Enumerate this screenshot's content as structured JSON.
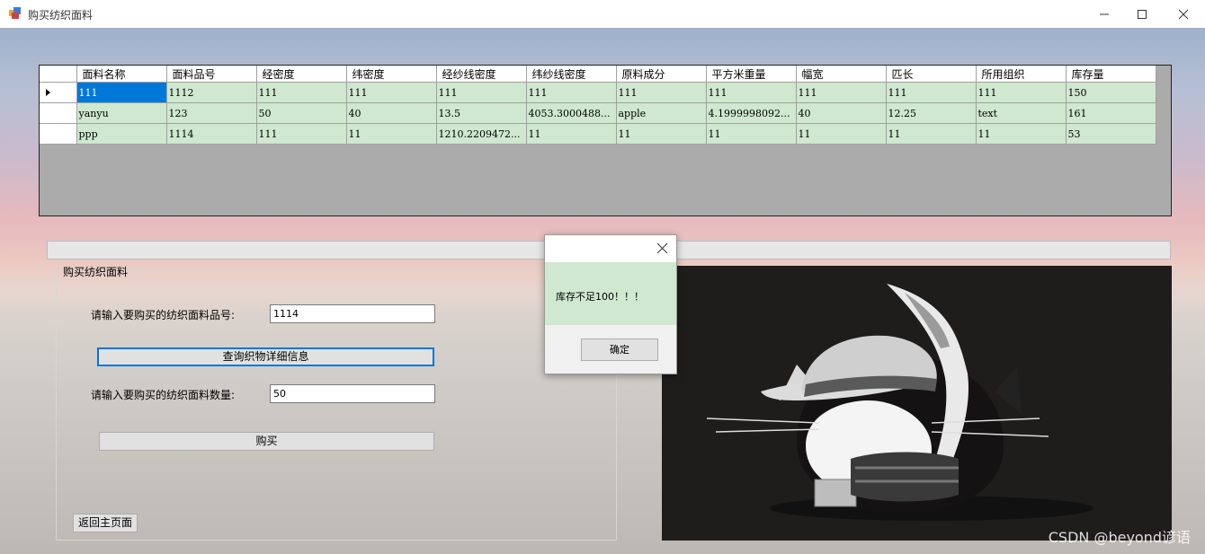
{
  "window": {
    "title": "购买纺织面料"
  },
  "grid": {
    "columns": [
      "面料名称",
      "面料品号",
      "经密度",
      "纬密度",
      "经纱线密度",
      "纬纱线密度",
      "原料成分",
      "平方米重量",
      "幅宽",
      "匹长",
      "所用组织",
      "库存量"
    ],
    "rows": [
      [
        "111",
        "1112",
        "111",
        "111",
        "111",
        "111",
        "111",
        "111",
        "111",
        "111",
        "111",
        "150"
      ],
      [
        "yanyu",
        "123",
        "50",
        "40",
        "13.5",
        "4053.3000488...",
        "apple",
        "4.1999998092...",
        "40",
        "12.25",
        "text",
        "161"
      ],
      [
        "ppp",
        "1114",
        "111",
        "11",
        "1210.2209472...",
        "11",
        "11",
        "11",
        "11",
        "11",
        "11",
        "53"
      ]
    ]
  },
  "purchase": {
    "group_title": "购买纺织面料",
    "item_label": "请输入要购买的纺织面料品号:",
    "item_value": "1114",
    "query_button": "查询织物详细信息",
    "qty_label": "请输入要购买的纺织面料数量:",
    "qty_value": "50",
    "buy_button": "购买",
    "back_button": "返回主页面"
  },
  "dialog": {
    "message": "库存不足100！！！",
    "ok_button": "确定"
  },
  "watermark": "CSDN @beyond谚语",
  "colors": {
    "row_bg": "#cfe8cf",
    "selection": "#0078d7",
    "grid_bg": "#ababab"
  }
}
